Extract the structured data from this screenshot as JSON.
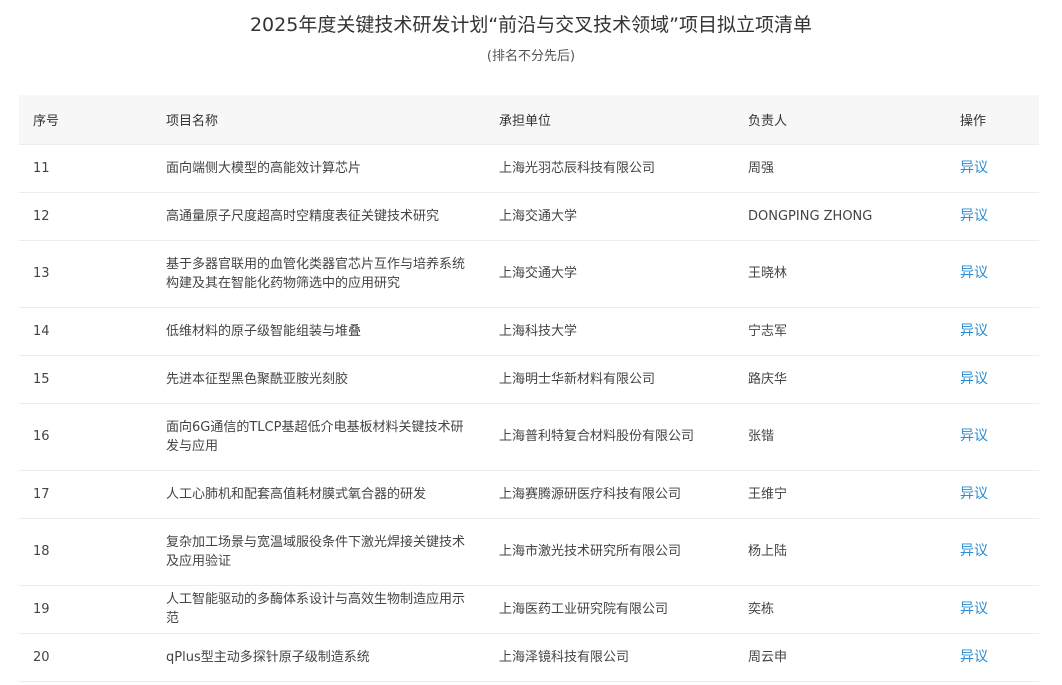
{
  "header": {
    "title": "2025年度关键技术研发计划“前沿与交叉技术领域”项目拟立项清单",
    "subtitle": "(排名不分先后)"
  },
  "table": {
    "columns": [
      "序号",
      "项目名称",
      "承担单位",
      "负责人",
      "操作"
    ],
    "rows": [
      {
        "no": "11",
        "name": "面向端侧大模型的高能效计算芯片",
        "org": "上海光羽芯辰科技有限公司",
        "lead": "周强",
        "action": "异议"
      },
      {
        "no": "12",
        "name": "高通量原子尺度超高时空精度表征关键技术研究",
        "org": "上海交通大学",
        "lead": "DONGPING ZHONG",
        "action": "异议"
      },
      {
        "no": "13",
        "name": "基于多器官联用的血管化类器官芯片互作与培养系统构建及其在智能化药物筛选中的应用研究",
        "org": "上海交通大学",
        "lead": "王晓林",
        "action": "异议"
      },
      {
        "no": "14",
        "name": "低维材料的原子级智能组装与堆叠",
        "org": "上海科技大学",
        "lead": "宁志军",
        "action": "异议"
      },
      {
        "no": "15",
        "name": "先进本征型黑色聚酰亚胺光刻胶",
        "org": "上海明士华新材料有限公司",
        "lead": "路庆华",
        "action": "异议"
      },
      {
        "no": "16",
        "name": "面向6G通信的TLCP基超低介电基板材料关键技术研发与应用",
        "org": "上海普利特复合材料股份有限公司",
        "lead": "张锴",
        "action": "异议"
      },
      {
        "no": "17",
        "name": "人工心肺机和配套高值耗材膜式氧合器的研发",
        "org": "上海赛腾源研医疗科技有限公司",
        "lead": "王维宁",
        "action": "异议"
      },
      {
        "no": "18",
        "name": "复杂加工场景与宽温域服役条件下激光焊接关键技术及应用验证",
        "org": "上海市激光技术研究所有限公司",
        "lead": "杨上陆",
        "action": "异议"
      },
      {
        "no": "19",
        "name": "人工智能驱动的多酶体系设计与高效生物制造应用示范",
        "org": "上海医药工业研究院有限公司",
        "lead": "奕栋",
        "action": "异议"
      },
      {
        "no": "20",
        "name": "qPlus型主动多探针原子级制造系统",
        "org": "上海泽镜科技有限公司",
        "lead": "周云申",
        "action": "异议"
      }
    ]
  }
}
